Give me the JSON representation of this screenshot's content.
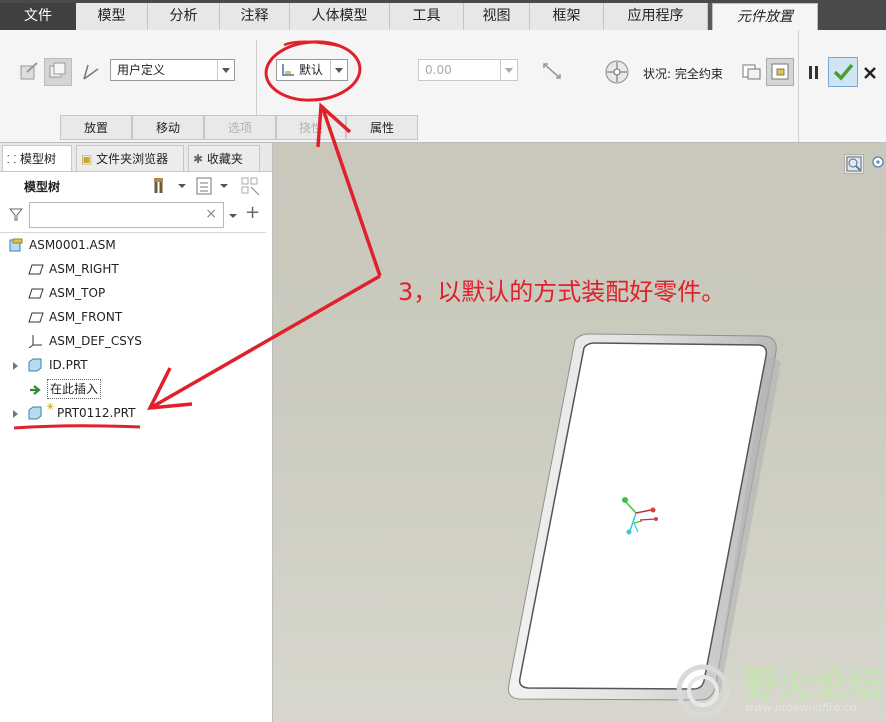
{
  "ribbon_tabs": [
    "文件",
    "模型",
    "分析",
    "注释",
    "人体模型",
    "工具",
    "视图",
    "框架",
    "应用程序",
    "元件放置"
  ],
  "constraint_set": "用户定义",
  "constraint_type": "默认",
  "offset_value": "0.00",
  "status_text": "状况: 完全约束",
  "subtabs": [
    "放置",
    "移动",
    "选项",
    "挠性",
    "属性"
  ],
  "panel_tabs": [
    "模型树",
    "文件夹浏览器",
    "收藏夹"
  ],
  "tree_title": "模型树",
  "tree_items": [
    {
      "label": "ASM0001.ASM"
    },
    {
      "label": "ASM_RIGHT"
    },
    {
      "label": "ASM_TOP"
    },
    {
      "label": "ASM_FRONT"
    },
    {
      "label": "ASM_DEF_CSYS"
    },
    {
      "label": "ID.PRT"
    },
    {
      "label": "在此插入"
    },
    {
      "label": "PRT0112.PRT"
    }
  ],
  "annotation_text": "3，以默认的方式装配好零件。",
  "watermark": {
    "name": "野火论坛",
    "url": "www.proewildfire.cn"
  },
  "colors": {
    "annotation_red": "#e0202a",
    "accent_check": "#4aa02c",
    "active_tab": "#f5f5f5"
  }
}
